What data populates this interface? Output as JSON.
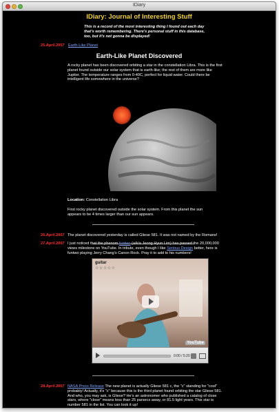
{
  "window": {
    "title": "IDiary"
  },
  "site": {
    "title": "IDiary: Journal of Interesting Stuff",
    "intro": "This is a record of the most interesting thing I found out each day that's worth remembering. There's personal stuff in this database, too, but it's not gonna be displayed!"
  },
  "entries": [
    {
      "date": "25.April.2007",
      "link": "Earth-Like Planet",
      "heading": "Earth-Like Planet Discovered",
      "body": "A rocky planet has been discovered orbiting a star in the constellation Libra. This is the first planet found outside our solar system that is earth-like; the rest of them are more like Jupiter. The temperature ranges from 0-40C, perfect for liquid water. Could there be intelligent life somewhere in the universe?",
      "location_label": "Location:",
      "location_value": "Constellation Libra",
      "note": "First rocky planet discovered outside the solar system. From this planet the sun appears to be 4 times larger than our sun appears."
    },
    {
      "date": "26.April.2007",
      "body": "The planet discovered yesterday is called Gliese 581. It was not named by the Romans!"
    },
    {
      "date": "27.April.2007",
      "body_pre": "I just noticed that the phenom",
      "link1": "funtwo",
      "body_mid": "(a/k/a Jeong Hyun Lim) has passed the 20,000,000 views milestone on YouTube. In tribute, even though I like",
      "link2": "Serious Design",
      "body_post": "better, here is funtwo playing Jerry Chang's Canon Rock. Pray it to add to his numbers!",
      "video": {
        "title": "guitar",
        "stars": "☆☆☆☆☆",
        "time": "0:00 / 5:20",
        "logo": "YouTube",
        "progress": 0.0
      }
    },
    {
      "date": "28.April.2007",
      "link": "NASA Press Release",
      "body": "The new planet is actually Gliese 581 c, the \"c\" standing for \"cool\" probably! Actually, it's \"c\" because this is the third planet found orbiting the star Gliese 581. And who, you may ask, is Gliese? He's an astronomer who published a catalog of close stars, where \"close\" means less than 25 parsecs away, or 81.5 light years. This star is number 581 in the list. You can look it up!"
    }
  ]
}
